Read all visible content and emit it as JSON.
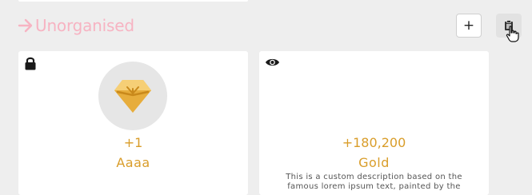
{
  "section": {
    "title": "Unorganised",
    "title_color": "#f7b3c2",
    "arrow_icon": "arrow-right-icon"
  },
  "toolbar": {
    "add_label": "+",
    "delete_icon": "clipboard-trash-icon"
  },
  "cards": [
    {
      "status_icon": "lock-icon",
      "image_icon": "gem-icon",
      "value": "+1",
      "name": "Aaaa",
      "accent": "#d99d2a"
    },
    {
      "status_icon": "eye-icon",
      "value": "+180,200",
      "name": "Gold",
      "description": "This is a custom description based on the famous lorem ipsum text, painted by the",
      "accent": "#d99d2a"
    }
  ]
}
